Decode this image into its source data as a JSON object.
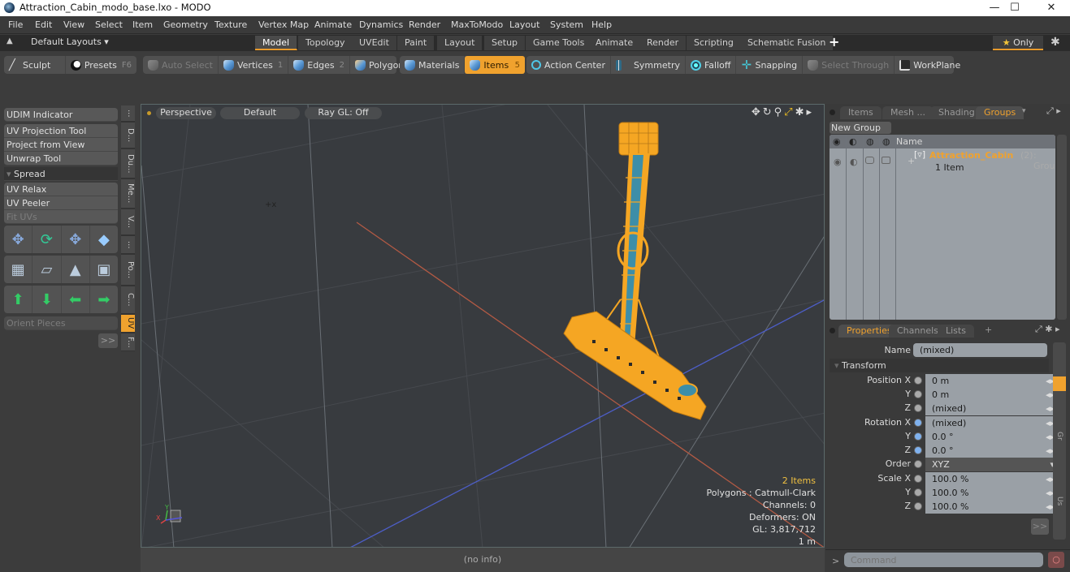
{
  "window": {
    "title": "Attraction_Cabin_modo_base.lxo - MODO",
    "controls": {
      "minimize": "—",
      "maximize": "☐",
      "close": "✕"
    }
  },
  "menu": [
    "File",
    "Edit",
    "View",
    "Select",
    "Item",
    "Geometry",
    "Texture",
    "Vertex Map",
    "Animate",
    "Dynamics",
    "Render",
    "MaxToModo",
    "Layout",
    "System",
    "Help"
  ],
  "layout_bar": {
    "layouts_label": "Default Layouts ▾",
    "tabs": [
      "Model",
      "Topology",
      "UVEdit",
      "Paint",
      "Layout",
      "Setup",
      "Game Tools",
      "Animate",
      "Render",
      "Scripting",
      "Schematic Fusion"
    ],
    "active_tab": "Model",
    "add_label": "+",
    "only_label": "Only",
    "star": "★"
  },
  "toolbar": {
    "sculpt": "Sculpt",
    "presets": "Presets",
    "presets_key": "F6",
    "auto_select": "Auto Select",
    "vertices": "Vertices",
    "vertices_key": "1",
    "edges": "Edges",
    "edges_key": "2",
    "polygons": "Polygons",
    "materials": "Materials",
    "items": "Items",
    "items_key": "5",
    "action_center": "Action Center",
    "symmetry": "Symmetry",
    "falloff": "Falloff",
    "snapping": "Snapping",
    "select_through": "Select Through",
    "workplane": "WorkPlane"
  },
  "left_panel": {
    "udim": "UDIM Indicator",
    "tools": [
      "UV Projection Tool",
      "Project from View",
      "Unwrap Tool"
    ],
    "spread_header": "Spread",
    "spread_tools": [
      "UV Relax",
      "UV Peeler",
      "Fit UVs"
    ],
    "orient_pieces": "Orient Pieces",
    "more": ">>",
    "vertical_tabs": [
      "...",
      "D...",
      "Du...",
      "Me...",
      "V...",
      "...",
      "Po...",
      "C...",
      "UV",
      "F..."
    ],
    "active_vertical_tab": "UV"
  },
  "viewport": {
    "view_mode": "Perspective",
    "shading": "Default",
    "raygl": "Ray GL: Off",
    "stats": {
      "items": "2 Items",
      "polygons": "Polygons : Catmull-Clark",
      "channels": "Channels: 0",
      "deformers": "Deformers: ON",
      "gl": "GL: 3,817,712",
      "scale": "1 m"
    },
    "status": "(no info)"
  },
  "right_panel": {
    "tabs": [
      "Items",
      "Mesh ...",
      "Shading",
      "Groups"
    ],
    "active_tab": "Groups",
    "new_group": "New Group",
    "name_header": "Name",
    "group": {
      "name": "Attraction_Cabin",
      "count": "(2)",
      "type": ": Group",
      "sub": "1 Item"
    },
    "props_tabs": [
      "Properties",
      "Channels",
      "Lists",
      "+"
    ],
    "active_props_tab": "Properties",
    "name_label": "Name",
    "name_value": "(mixed)",
    "transform_header": "Transform",
    "position": [
      {
        "label": "Position X",
        "value": "0 m"
      },
      {
        "label": "Y",
        "value": "0 m"
      },
      {
        "label": "Z",
        "value": "(mixed)"
      }
    ],
    "rotation": [
      {
        "label": "Rotation X",
        "value": "(mixed)"
      },
      {
        "label": "Y",
        "value": "0.0 °"
      },
      {
        "label": "Z",
        "value": "0.0 °"
      }
    ],
    "order": {
      "label": "Order",
      "value": "XYZ"
    },
    "scale": [
      {
        "label": "Scale X",
        "value": "100.0 %"
      },
      {
        "label": "Y",
        "value": "100.0 %"
      },
      {
        "label": "Z",
        "value": "100.0 %"
      }
    ],
    "more": ">>",
    "command_placeholder": "Command",
    "command_prompt": ">"
  },
  "colors": {
    "accent": "#f0a22e",
    "selection": "#f5a623",
    "x_axis": "#c0503a",
    "z_axis": "#4a5fc8"
  }
}
